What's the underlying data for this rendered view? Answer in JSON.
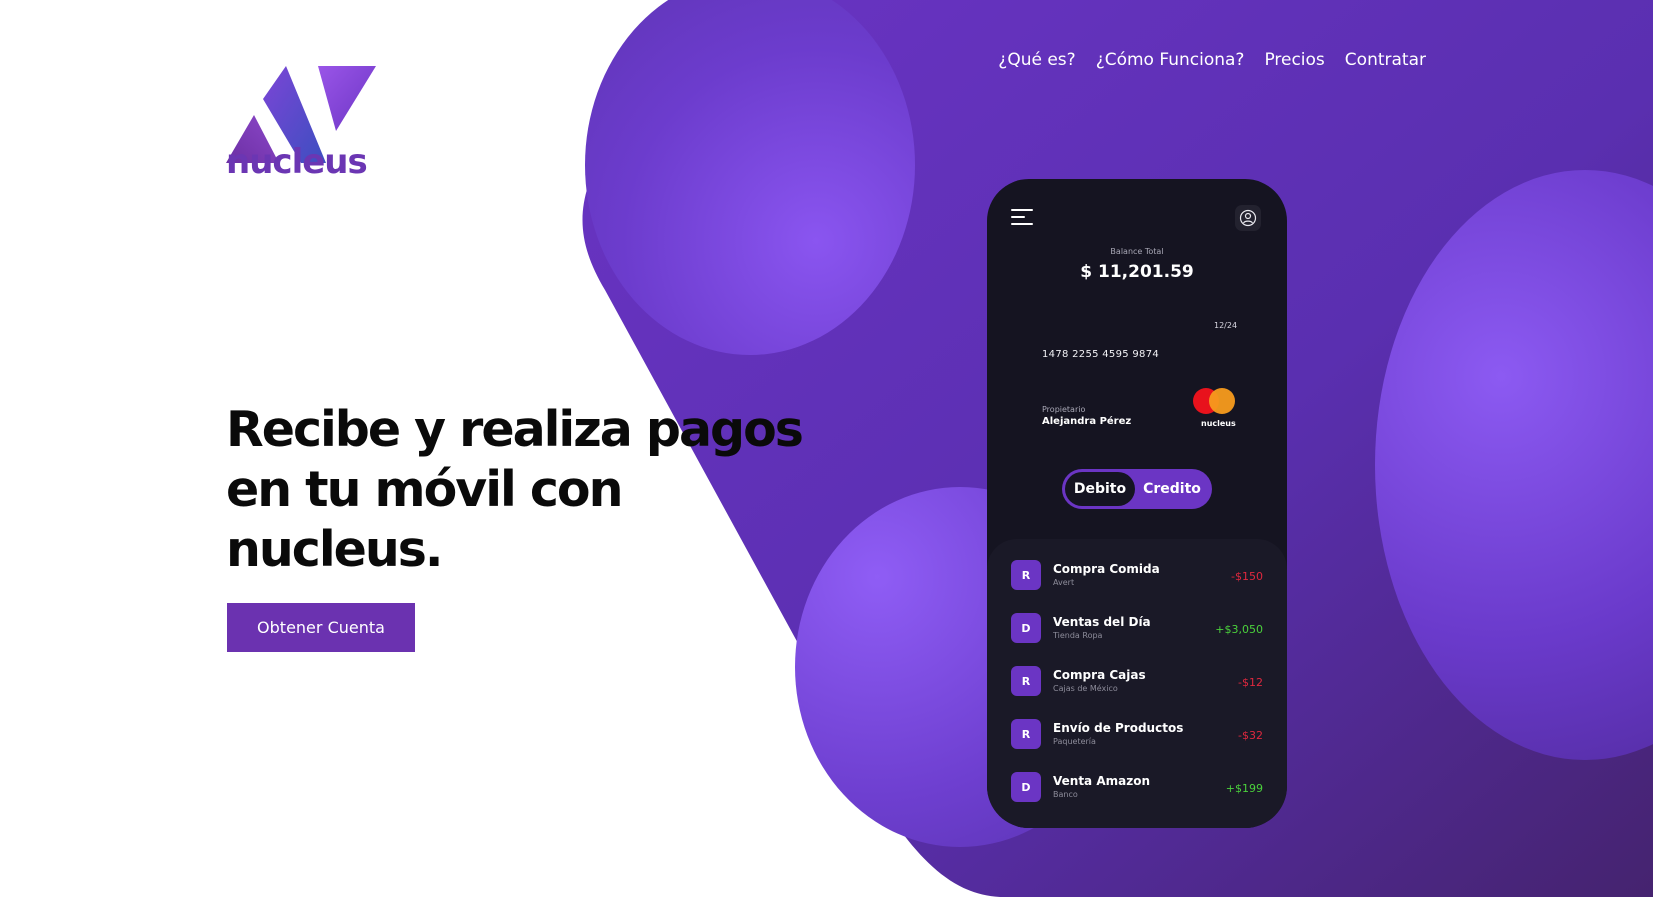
{
  "brand": {
    "name": "nucleus"
  },
  "nav": {
    "items": [
      {
        "label": "¿Qué es?"
      },
      {
        "label": "¿Cómo Funciona?"
      },
      {
        "label": "Precios"
      },
      {
        "label": "Contratar"
      }
    ]
  },
  "hero": {
    "line1": "Recibe y realiza pagos",
    "line2": "en tu móvil con",
    "line3": "nucleus.",
    "cta": "Obtener Cuenta"
  },
  "phone": {
    "balance_label": "Balance Total",
    "balance_value": "$ 11,201.59",
    "card": {
      "expiry": "12/24",
      "number": "1478 2255 4595 9874",
      "owner_label": "Propietario",
      "owner_name": "Alejandra Pérez",
      "brand": "nucleus"
    },
    "toggle": {
      "debit": "Debito",
      "credit": "Credito",
      "selected": "Debito"
    },
    "transactions": [
      {
        "initial": "R",
        "title": "Compra Comida",
        "subtitle": "Avert",
        "amount": "-$150"
      },
      {
        "initial": "D",
        "title": "Ventas del Día",
        "subtitle": "Tienda Ropa",
        "amount": "+$3,050"
      },
      {
        "initial": "R",
        "title": "Compra Cajas",
        "subtitle": "Cajas de México",
        "amount": "-$12"
      },
      {
        "initial": "R",
        "title": "Envío de Productos",
        "subtitle": "Paquetería",
        "amount": "-$32"
      },
      {
        "initial": "D",
        "title": "Venta Amazon",
        "subtitle": "Banco",
        "amount": "+$199"
      }
    ]
  },
  "colors": {
    "primary": "#6b32b0",
    "purple_bg": "#5a2fb0",
    "phone_bg": "#151421",
    "negative": "#e0283e",
    "positive": "#4bd13c"
  },
  "icons": [
    "menu-icon",
    "user-icon",
    "mastercard-logo"
  ]
}
